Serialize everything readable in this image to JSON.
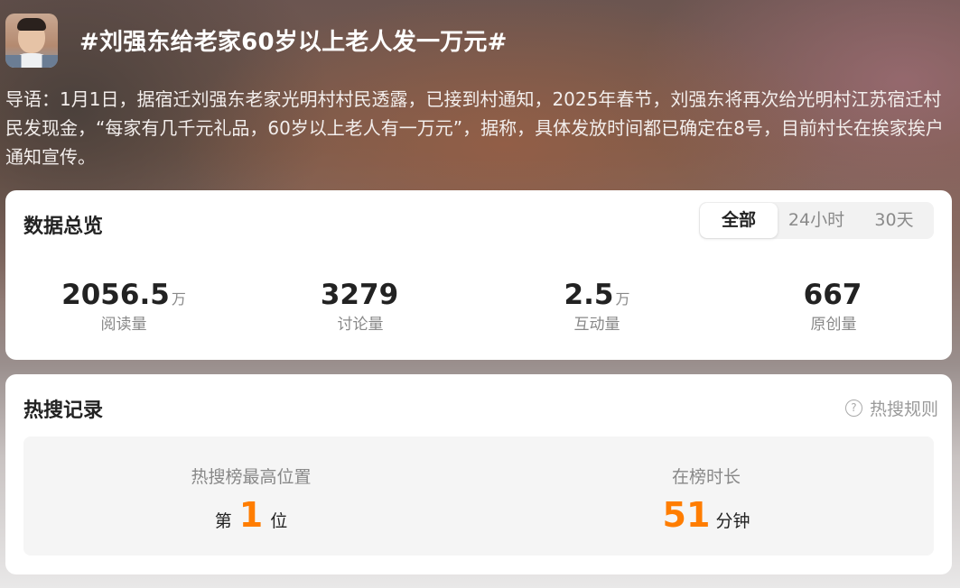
{
  "header": {
    "avatar_alt": "avatar",
    "title": "#刘强东给老家60岁以上老人发一万元#",
    "lead": "导语：1月1日，据宿迁刘强东老家光明村村民透露，已接到村通知，2025年春节，刘强东将再次给光明村江苏宿迁村民发现金，“每家有几千元礼品，60岁以上老人有一万元”，据称，具体发放时间都已确定在8号，目前村长在挨家挨户通知宣传。"
  },
  "overview": {
    "title": "数据总览",
    "tabs": [
      {
        "label": "全部",
        "active": true
      },
      {
        "label": "24小时",
        "active": false
      },
      {
        "label": "30天",
        "active": false
      }
    ],
    "stats": [
      {
        "value": "2056.5",
        "unit": "万",
        "label": "阅读量"
      },
      {
        "value": "3279",
        "unit": "",
        "label": "讨论量"
      },
      {
        "value": "2.5",
        "unit": "万",
        "label": "互动量"
      },
      {
        "value": "667",
        "unit": "",
        "label": "原创量"
      }
    ]
  },
  "hot": {
    "title": "热搜记录",
    "rules_label": "热搜规则",
    "rules_icon": "question-circle-icon",
    "peak": {
      "label": "热搜榜最高位置",
      "prefix": "第",
      "value": "1",
      "suffix": "位"
    },
    "duration": {
      "label": "在榜时长",
      "value": "51",
      "suffix": "分钟"
    }
  },
  "colors": {
    "accent_orange": "#ff7d00",
    "card_bg": "#ffffff",
    "panel_bg": "#f5f5f5"
  }
}
